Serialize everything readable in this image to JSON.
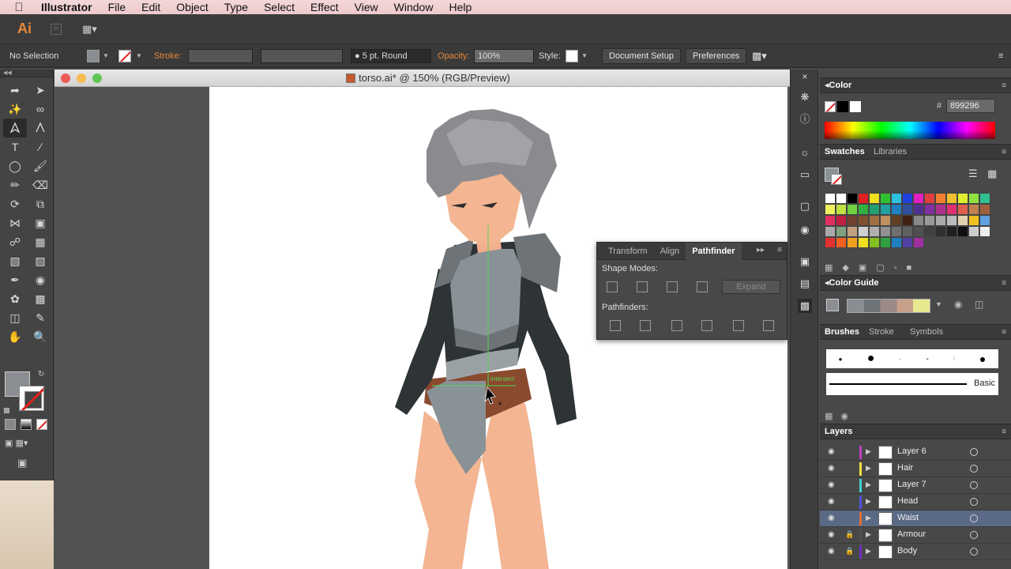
{
  "menubar": {
    "app": "Illustrator",
    "items": [
      "File",
      "Edit",
      "Object",
      "Type",
      "Select",
      "Effect",
      "View",
      "Window",
      "Help"
    ]
  },
  "appbar": {
    "logo": "Ai",
    "bridge": "Br"
  },
  "control": {
    "selection": "No Selection",
    "stroke_label": "Stroke:",
    "brush": "5 pt. Round",
    "opacity_label": "Opacity:",
    "opacity": "100%",
    "style_label": "Style:",
    "document_setup": "Document Setup",
    "preferences": "Preferences"
  },
  "document": {
    "title": "torso.ai* @ 150% (RGB/Preview)",
    "smart_guide": "intersect"
  },
  "pathfinder": {
    "tabs": [
      "Transform",
      "Align",
      "Pathfinder"
    ],
    "shape_modes": "Shape Modes:",
    "pathfinders": "Pathfinders:",
    "expand": "Expand"
  },
  "color": {
    "title": "Color",
    "hex_label": "#",
    "hex": "899296"
  },
  "swatches": {
    "tabs": [
      "Swatches",
      "Libraries"
    ]
  },
  "color_guide": {
    "title": "Color Guide"
  },
  "brushes": {
    "tabs": [
      "Brushes",
      "Stroke",
      "Symbols"
    ],
    "basic": "Basic"
  },
  "layers": {
    "title": "Layers",
    "items": [
      {
        "name": "Layer 6",
        "color": "#c040c0"
      },
      {
        "name": "Hair",
        "color": "#f0e040"
      },
      {
        "name": "Layer 7",
        "color": "#40d0d0"
      },
      {
        "name": "Head",
        "color": "#5050e0"
      },
      {
        "name": "Waist",
        "color": "#e07030"
      },
      {
        "name": "Armour",
        "color": "#505050"
      },
      {
        "name": "Body",
        "color": "#7030c0"
      }
    ],
    "selected": "Waist"
  }
}
